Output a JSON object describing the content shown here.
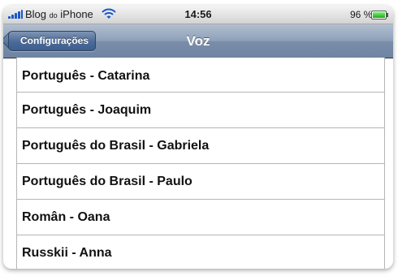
{
  "status_bar": {
    "carrier_main": "Blog",
    "carrier_small": "do",
    "carrier_device": "iPhone",
    "time": "14:56",
    "battery": "96 %"
  },
  "nav": {
    "back_label": "Configurações",
    "title": "Voz"
  },
  "voices": [
    "Português - Catarina",
    "Português - Joaquim",
    "Português do Brasil - Gabriela",
    "Português do Brasil - Paulo",
    "Român - Oana",
    "Russkii - Anna"
  ],
  "colors": {
    "signal": "#1b56c9",
    "battery": "#1fa81a",
    "nav_bar": "#6e84a3"
  }
}
